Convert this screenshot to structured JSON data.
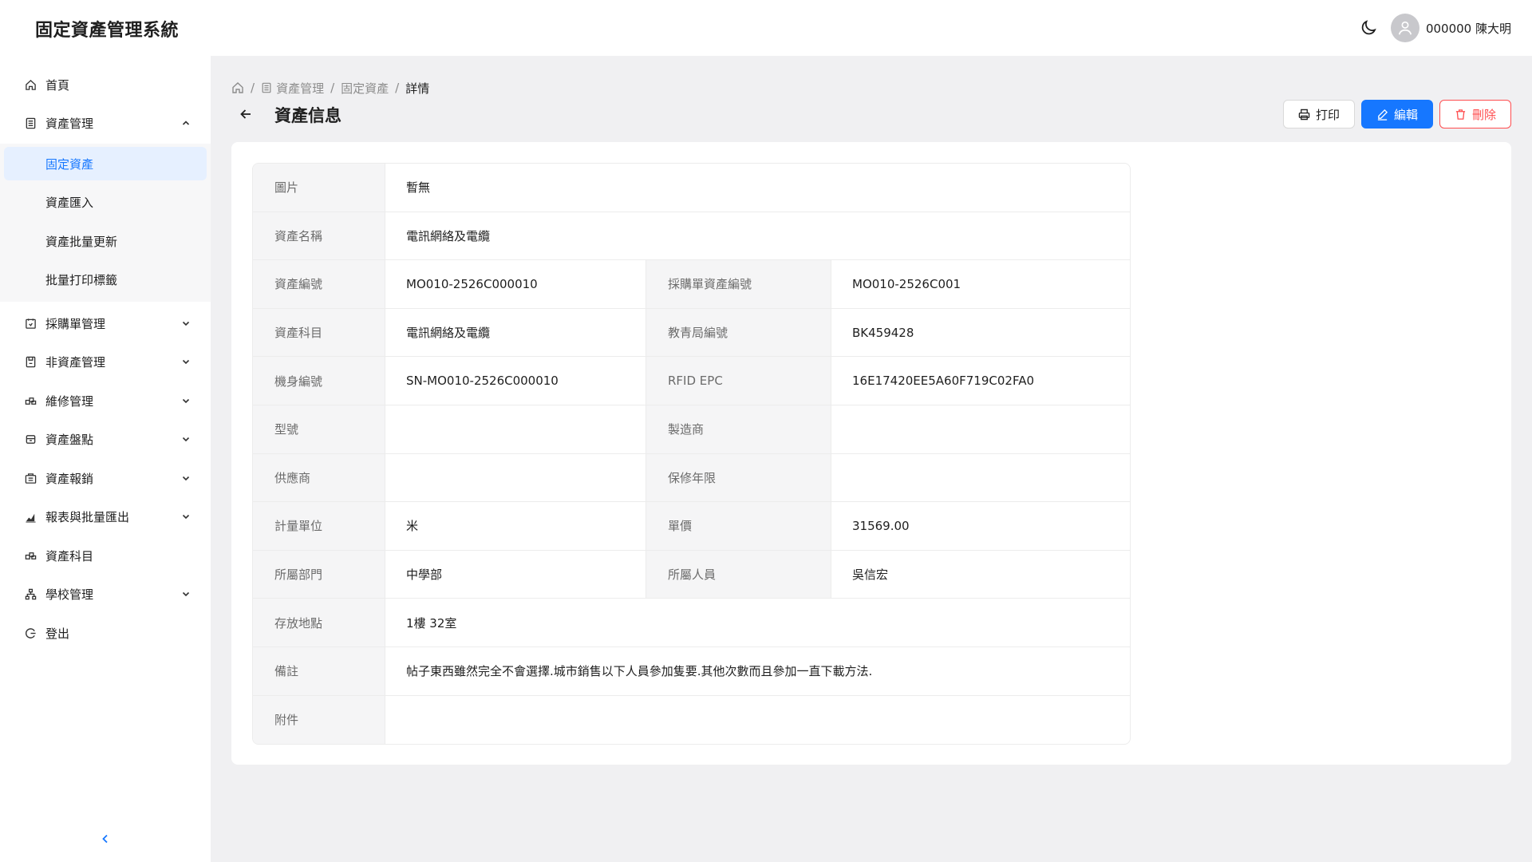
{
  "app": {
    "title": "固定資產管理系統",
    "user_label": "000000 陳大明"
  },
  "sidebar": {
    "items": [
      {
        "label": "首頁",
        "icon": "home-icon"
      },
      {
        "label": "資產管理",
        "icon": "list-icon"
      },
      {
        "label": "採購單管理",
        "icon": "purchase-icon"
      },
      {
        "label": "非資產管理",
        "icon": "box-icon"
      },
      {
        "label": "維修管理",
        "icon": "repair-icon"
      },
      {
        "label": "資產盤點",
        "icon": "inventory-icon"
      },
      {
        "label": "資產報銷",
        "icon": "writeoff-icon"
      },
      {
        "label": "報表與批量匯出",
        "icon": "chart-icon"
      },
      {
        "label": "資產科目",
        "icon": "category-icon"
      },
      {
        "label": "學校管理",
        "icon": "org-icon"
      },
      {
        "label": "登出",
        "icon": "logout-icon"
      }
    ],
    "sub_items": [
      {
        "label": "固定資產"
      },
      {
        "label": "資產匯入"
      },
      {
        "label": "資產批量更新"
      },
      {
        "label": "批量打印標籤"
      }
    ]
  },
  "breadcrumb": {
    "level1": "資產管理",
    "level2": "固定資產",
    "current": "詳情"
  },
  "page": {
    "title": "資產信息"
  },
  "actions": {
    "print": "打印",
    "edit": "編輯",
    "delete": "刪除"
  },
  "details": {
    "image_label": "圖片",
    "image_value": "暫無",
    "name_label": "資產名稱",
    "name_value": "電訊網絡及電纜",
    "code_label": "資產編號",
    "code_value": "MO010-2526C000010",
    "po_code_label": "採購單資產編號",
    "po_code_value": "MO010-2526C001",
    "subject_label": "資產科目",
    "subject_value": "電訊網絡及電纜",
    "edb_code_label": "教青局編號",
    "edb_code_value": "BK459428",
    "serial_label": "機身編號",
    "serial_value": "SN-MO010-2526C000010",
    "rfid_label": "RFID EPC",
    "rfid_value": "16E17420EE5A60F719C02FA0",
    "model_label": "型號",
    "model_value": "",
    "maker_label": "製造商",
    "maker_value": "",
    "supplier_label": "供應商",
    "supplier_value": "",
    "warranty_label": "保修年限",
    "warranty_value": "",
    "unit_label": "計量單位",
    "unit_value": "米",
    "price_label": "單價",
    "price_value": "31569.00",
    "dept_label": "所屬部門",
    "dept_value": "中學部",
    "person_label": "所屬人員",
    "person_value": "吳信宏",
    "location_label": "存放地點",
    "location_value": "1樓 32室",
    "remark_label": "備註",
    "remark_value": "帖子東西雖然完全不會選擇.城市銷售以下人員參加隻要.其他次數而且參加一直下載方法.",
    "attachment_label": "附件",
    "attachment_value": ""
  }
}
